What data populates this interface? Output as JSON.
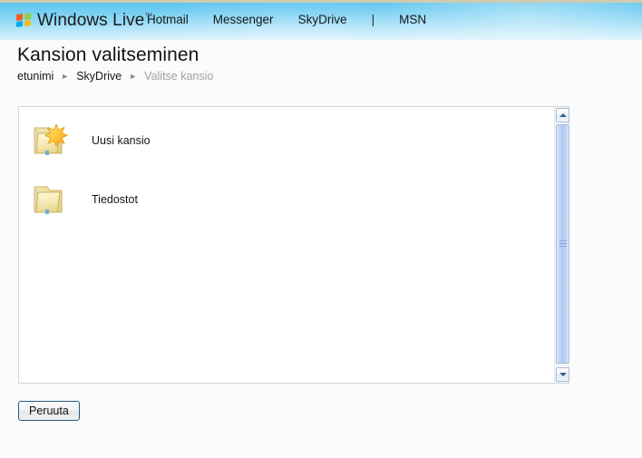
{
  "header": {
    "brand": {
      "name": "Windows Live",
      "trademark": "™",
      "logo_icon": "windows-flag-icon"
    },
    "nav": [
      {
        "label": "Hotmail"
      },
      {
        "label": "Messenger"
      },
      {
        "label": "SkyDrive"
      },
      {
        "label": "|"
      },
      {
        "label": "MSN"
      }
    ],
    "colors": {
      "gradient_top": "#5fc5ef",
      "gradient_bottom": "#d8f1fb",
      "chrome_strip": "#cfcbb0"
    }
  },
  "page": {
    "title": "Kansion valitseminen",
    "breadcrumb": {
      "arrow_glyph": "►",
      "items": [
        {
          "label": "etunimi",
          "current": false
        },
        {
          "label": "SkyDrive",
          "current": false
        },
        {
          "label": "Valitse kansio",
          "current": true
        }
      ]
    }
  },
  "folder_list": {
    "items": [
      {
        "label": "Uusi kansio",
        "icon": "new-folder-icon"
      },
      {
        "label": "Tiedostot",
        "icon": "folder-icon"
      }
    ],
    "scrollbar": {
      "up_arrow_icon": "chevron-up-icon",
      "down_arrow_icon": "chevron-down-icon",
      "grip_icon": "scrollbar-grip-icon",
      "thumb_position": "top"
    },
    "colors": {
      "border": "#d6d6d6",
      "background": "#ffffff",
      "scrollbar_thumb": "#b2c8f2"
    }
  },
  "footer": {
    "cancel_label": "Peruuta",
    "cancel_focus_border": "#245a80"
  }
}
